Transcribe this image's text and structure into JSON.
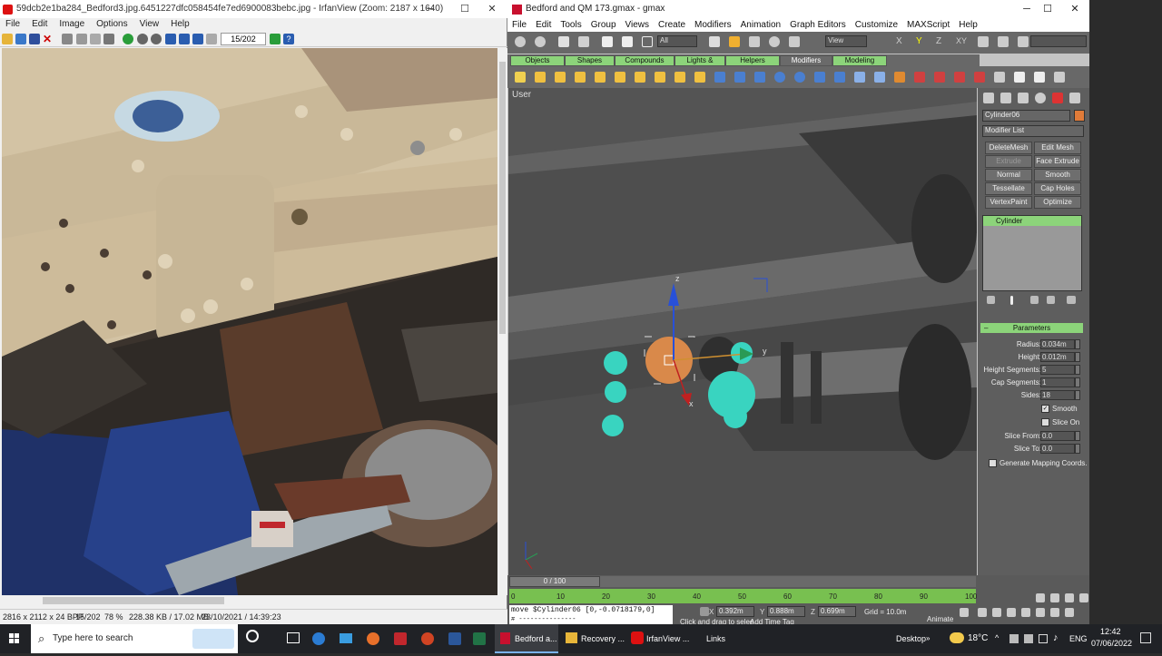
{
  "irfanview": {
    "title": "59dcb2e1ba284_Bedford3.jpg.6451227dfc058454fe7ed6900083bebc.jpg - IrfanView (Zoom: 2187 x 1640)",
    "menu": [
      "File",
      "Edit",
      "Image",
      "Options",
      "View",
      "Help"
    ],
    "page_counter": "15/202",
    "status": {
      "dims": "2816 x 2112 x 24 BPP",
      "page": "15/202",
      "zoom": "78 %",
      "size": "228.38 KB / 17.02 MB",
      "date": "23/10/2021 / 14:39:23"
    }
  },
  "gmax": {
    "title": "Bedford and QM 173.gmax - gmax",
    "menu": [
      "File",
      "Edit",
      "Tools",
      "Group",
      "Views",
      "Create",
      "Modifiers",
      "Animation",
      "Graph Editors",
      "Customize",
      "MAXScript",
      "Help"
    ],
    "selection_filter": "All",
    "ref_coord": "View",
    "tabs": [
      "Objects",
      "Shapes",
      "Compounds",
      "Lights & Cameras",
      "Helpers",
      "Modifiers",
      "Modeling"
    ],
    "viewport_label": "User",
    "object_name": "Cylinder06",
    "modifier_list": "Modifier List",
    "modifier_buttons": [
      "DeleteMesh",
      "Edit Mesh",
      "Extrude",
      "Face Extrude",
      "Normal",
      "Smooth",
      "Tessellate",
      "Cap Holes",
      "VertexPaint",
      "Optimize"
    ],
    "stack_item": "Cylinder",
    "parameters": {
      "header": "Parameters",
      "rows": [
        {
          "label": "Radius:",
          "value": "0.034m"
        },
        {
          "label": "Height:",
          "value": "0.012m"
        },
        {
          "label": "Height Segments:",
          "value": "5"
        },
        {
          "label": "Cap Segments:",
          "value": "1"
        },
        {
          "label": "Sides:",
          "value": "18"
        }
      ],
      "smooth_label": "Smooth",
      "smooth_checked": true,
      "slice_on_label": "Slice On",
      "slice_on_checked": false,
      "slice_rows": [
        {
          "label": "Slice From:",
          "value": "0.0"
        },
        {
          "label": "Slice To:",
          "value": "0.0"
        }
      ],
      "gen_mapping_label": "Generate Mapping Coords."
    },
    "time_slider": "0 / 100",
    "timeline_ticks": [
      "0",
      "10",
      "20",
      "30",
      "40",
      "50",
      "60",
      "70",
      "80",
      "90",
      "100"
    ],
    "maxscript_line": "move $Cylinder06 [0,-0.0718179,0]",
    "maxscript_line2": "# ---------------",
    "prompt": "Click and drag to selec",
    "add_time_tag": "Add Time Tag",
    "coords": {
      "x": "0.392m",
      "y": "0.888m",
      "z": "0.699m"
    },
    "grid": "Grid = 10.0m",
    "animate": "Animate",
    "axis_labels": {
      "x": "x",
      "y": "y",
      "z": "z"
    }
  },
  "taskbar": {
    "search_placeholder": "Type here to search",
    "apps": [
      {
        "label": "Bedford a..."
      },
      {
        "label": "Recovery ..."
      },
      {
        "label": "IrfanView ..."
      },
      {
        "label": "Links"
      }
    ],
    "desktop": "Desktop",
    "temp": "18°C",
    "lang": "ENG",
    "time": "12:42",
    "date": "07/06/2022"
  }
}
